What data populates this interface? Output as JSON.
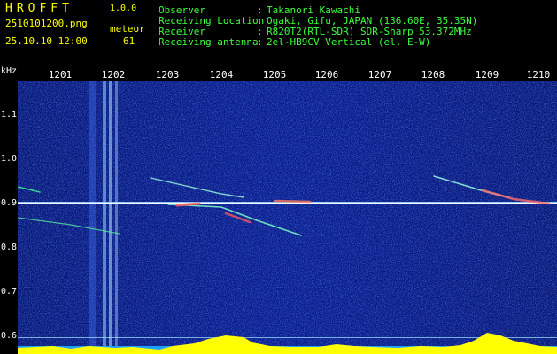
{
  "header": {
    "logo": "HROFFT",
    "version": "1.0.0",
    "filename": "2510101200.png",
    "meteor_label": "meteor",
    "datetime": "25.10.10 12:00",
    "meteor_count": "61"
  },
  "info": [
    {
      "label": "Observer",
      "value": "Takanori Kawachi"
    },
    {
      "label": "Receiving Location",
      "value": "Ogaki, Gifu, JAPAN (136.60E, 35.35N)"
    },
    {
      "label": "Receiver",
      "value": "R820T2(RTL-SDR) SDR-Sharp 53.372MHz"
    },
    {
      "label": "Receiving antenna",
      "value": "2el-HB9CV Vertical (el. E-W)"
    }
  ],
  "colon": ":",
  "axis": {
    "y_unit": "kHz",
    "x_ticks": [
      "1201",
      "1202",
      "1203",
      "1204",
      "1205",
      "1206",
      "1207",
      "1208",
      "1209",
      "1210"
    ],
    "y_ticks": [
      "1.1",
      "1.0",
      "0.9",
      "0.8",
      "0.7",
      "0.6"
    ]
  },
  "colors": {
    "background": "#000000",
    "label_green": "#3cff3c",
    "label_yellow": "#ffff00",
    "tick_white": "#ffffff",
    "spectrogram_base": "#0a1a8c",
    "signal_yellow": "#ffff00"
  }
}
